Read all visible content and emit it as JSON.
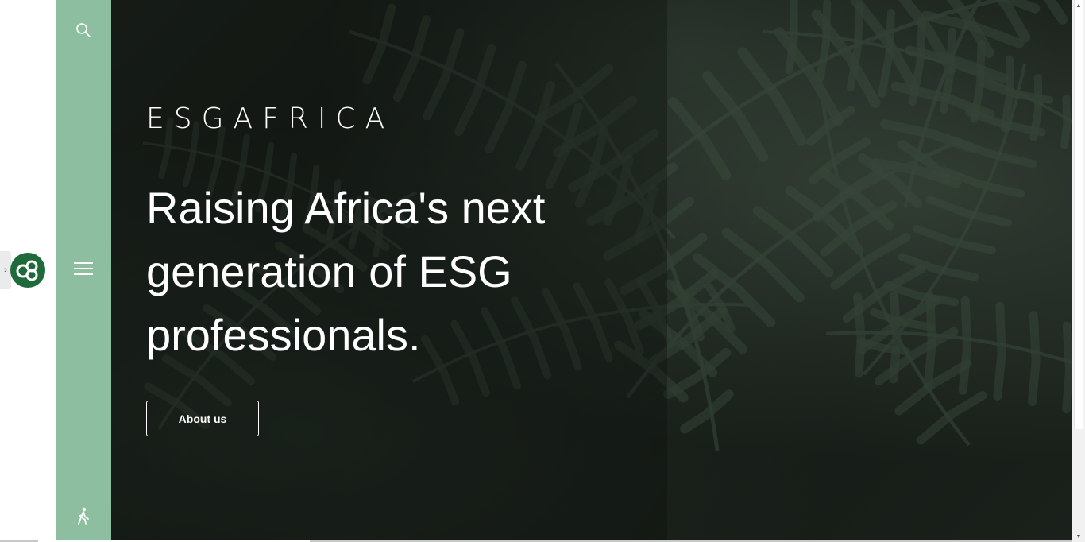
{
  "brand": {
    "name": "ESGAFRICA",
    "logo_icon": "esg-africa-logo-icon"
  },
  "sidebar": {
    "search_icon": "search-icon",
    "menu_icon": "hamburger-menu-icon",
    "accessibility_icon": "accessibility-walking-icon"
  },
  "hero": {
    "headline": "Raising Africa's next generation of ESG professionals.",
    "cta_label": "About us"
  },
  "colors": {
    "sidebar": "#8dbea0",
    "logo": "#1f6a3a",
    "hero_dark": "#141a15",
    "text": "#ffffff"
  }
}
